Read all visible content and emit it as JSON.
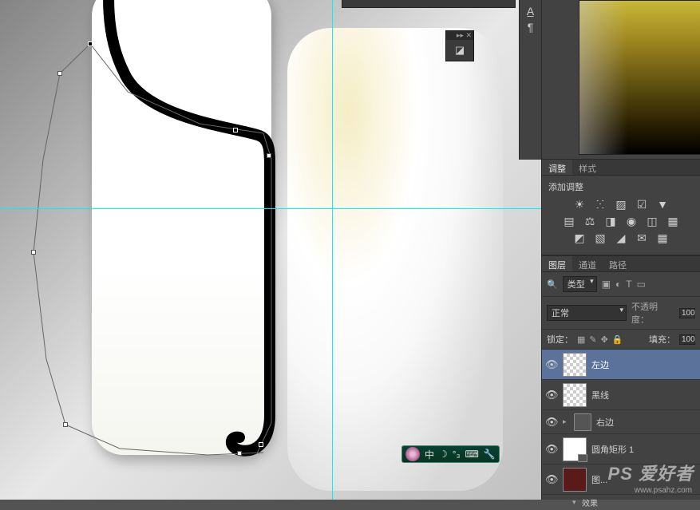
{
  "ime": {
    "text": "中",
    "moon": "☽",
    "punct": "°₃",
    "kb": "⌨",
    "wrench": "🔧"
  },
  "side_strip": {
    "icon1": "A̲",
    "icon2": "¶"
  },
  "mini_panel": {
    "collapse": "▸▸",
    "close": "✕",
    "icon": "◪"
  },
  "adjust": {
    "tab1": "调整",
    "tab2": "样式",
    "title": "添加调整",
    "row1": [
      "☀",
      "ⵘ",
      "▨",
      "☑",
      "▼"
    ],
    "row2": [
      "▤",
      "⚖",
      "◨",
      "◉",
      "◫",
      "▦"
    ],
    "row3": [
      "◩",
      "▧",
      "◢",
      "✉",
      "▦"
    ]
  },
  "layers": {
    "tab1": "图层",
    "tab2": "通道",
    "tab3": "路径",
    "filter_kind": "类型",
    "filter_icons": [
      "▣",
      "◐",
      "T",
      "▭"
    ],
    "search_icon": "🔍",
    "blend": "正常",
    "opacity_label": "不透明度：",
    "opacity_val": "100",
    "lock_label": "锁定：",
    "lock_icons": [
      "▦",
      "✎",
      "✥",
      "🔒"
    ],
    "fill_label": "填充：",
    "fill_val": "100",
    "items": [
      {
        "name": "左边",
        "eye": "👁",
        "thumb": "transparent"
      },
      {
        "name": "黑线",
        "eye": "👁",
        "thumb": "transparent"
      },
      {
        "name": "右边",
        "eye": "👁",
        "thumb": "folder",
        "twisty": "▸"
      },
      {
        "name": "圆角矩形 1",
        "eye": "👁",
        "thumb": "shape"
      },
      {
        "name": "图...",
        "eye": "👁",
        "thumb": "dark"
      }
    ],
    "fx": "效果"
  },
  "watermark": {
    "main": "PS 爱好者",
    "sub": "www.psahz.com"
  }
}
